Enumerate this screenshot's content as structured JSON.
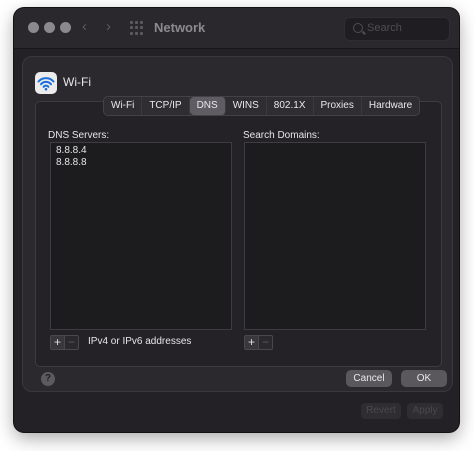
{
  "window": {
    "title": "Network",
    "search_placeholder": "Search",
    "revert_label": "Revert",
    "apply_label": "Apply"
  },
  "sheet": {
    "interface_name": "Wi-Fi",
    "tabs": [
      {
        "label": "Wi-Fi",
        "active": false
      },
      {
        "label": "TCP/IP",
        "active": false
      },
      {
        "label": "DNS",
        "active": true
      },
      {
        "label": "WINS",
        "active": false
      },
      {
        "label": "802.1X",
        "active": false
      },
      {
        "label": "Proxies",
        "active": false
      },
      {
        "label": "Hardware",
        "active": false
      }
    ],
    "dns": {
      "servers_label": "DNS Servers:",
      "servers": [
        "8.8.8.4",
        "8.8.8.8"
      ],
      "hint": "IPv4 or IPv6 addresses",
      "search_domains_label": "Search Domains:",
      "search_domains": []
    },
    "help_label": "?",
    "cancel_label": "Cancel",
    "ok_label": "OK"
  },
  "icons": {
    "plus": "+",
    "minus": "−",
    "back": "‹",
    "forward": "›"
  }
}
